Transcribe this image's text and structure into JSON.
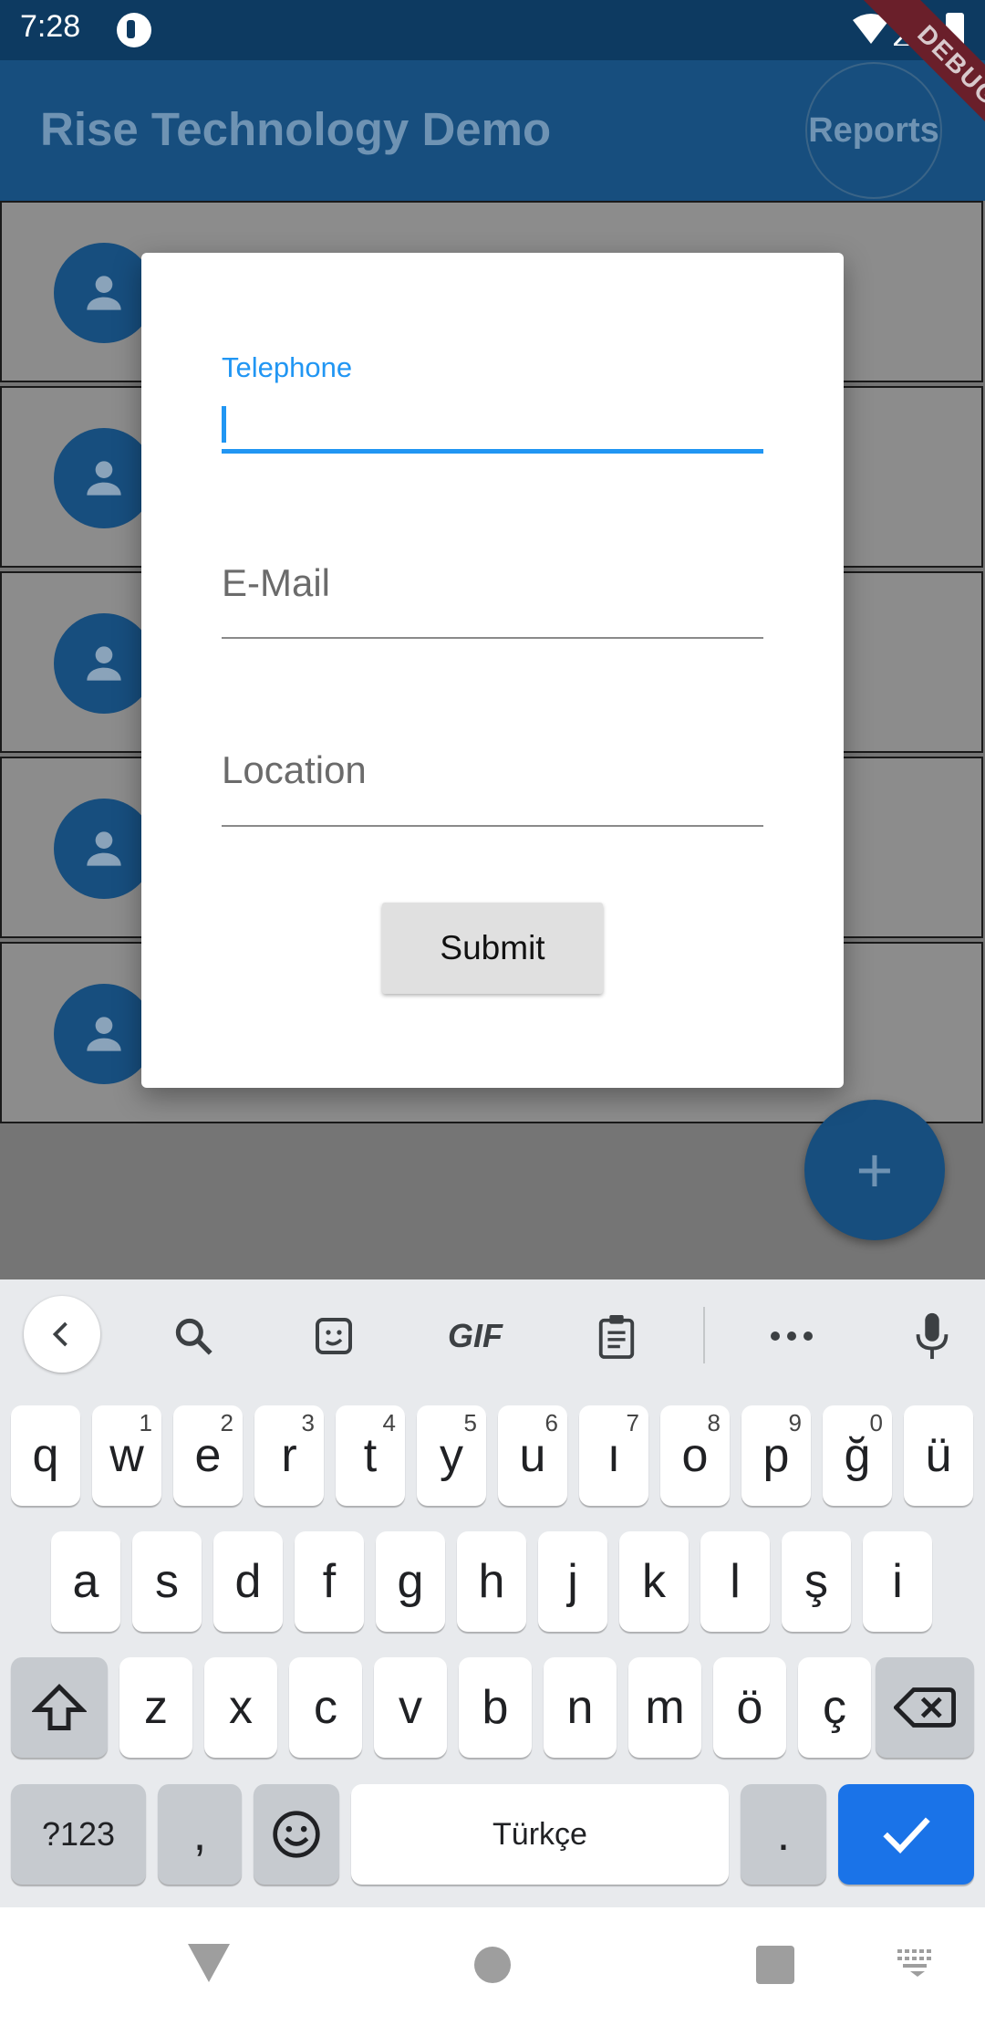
{
  "status_bar": {
    "time": "7:28"
  },
  "app_bar": {
    "title": "Rise Technology Demo",
    "reports_label": "Reports",
    "debug_banner": "DEBUG"
  },
  "dialog": {
    "telephone_label": "Telephone",
    "email_label": "E-Mail",
    "location_label": "Location",
    "submit_label": "Submit"
  },
  "fab_label": "+",
  "keyboard": {
    "row1": [
      [
        "q",
        ""
      ],
      [
        "w",
        "1"
      ],
      [
        "e",
        "2"
      ],
      [
        "r",
        "3"
      ],
      [
        "t",
        "4"
      ],
      [
        "y",
        "5"
      ],
      [
        "u",
        "6"
      ],
      [
        "ı",
        "7"
      ],
      [
        "o",
        "8"
      ],
      [
        "p",
        "9"
      ],
      [
        "ğ",
        "0"
      ],
      [
        "ü",
        ""
      ]
    ],
    "row2": [
      "a",
      "s",
      "d",
      "f",
      "g",
      "h",
      "j",
      "k",
      "l",
      "ş",
      "i"
    ],
    "row3": [
      "z",
      "x",
      "c",
      "v",
      "b",
      "n",
      "m",
      "ö",
      "ç"
    ],
    "symbols_label": "?123",
    "comma_label": ",",
    "space_label": "Türkçe",
    "period_label": ".",
    "toolbar": [
      "back-icon",
      "search-icon",
      "sticker-icon",
      "gif",
      "clipboard-icon",
      "more-icon",
      "mic-icon"
    ],
    "gif_label": "GIF"
  }
}
